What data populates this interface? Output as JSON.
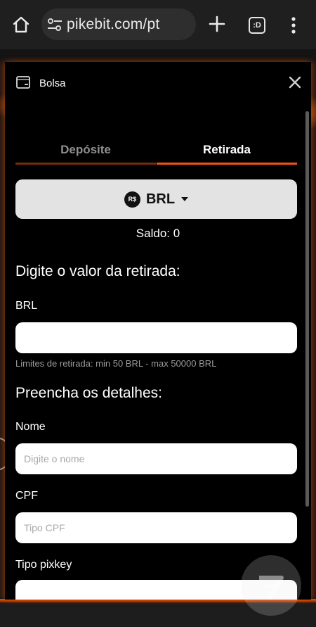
{
  "browser": {
    "url": "pikebit.com/pt",
    "tabs_label": ":D"
  },
  "modal": {
    "title": "Bolsa",
    "tabs": [
      {
        "label": "Depósite",
        "active": false
      },
      {
        "label": "Retirada",
        "active": true
      }
    ],
    "currency": {
      "code": "BRL",
      "symbol": "R$"
    },
    "balance": "Saldo: 0",
    "amount_section_title": "Digite o valor da retirada:",
    "amount_label": "BRL",
    "amount_value": "",
    "limits_hint": "Limites de retirada: min 50 BRL - max 50000 BRL",
    "details_section_title": "Preencha os detalhes:",
    "name_label": "Nome",
    "name_placeholder": "Digite o nome",
    "cpf_label": "CPF",
    "cpf_placeholder": "Tipo CPF",
    "pixkey_label": "Tipo pixkey"
  },
  "colors": {
    "accent": "#f55314",
    "background": "#000000"
  }
}
